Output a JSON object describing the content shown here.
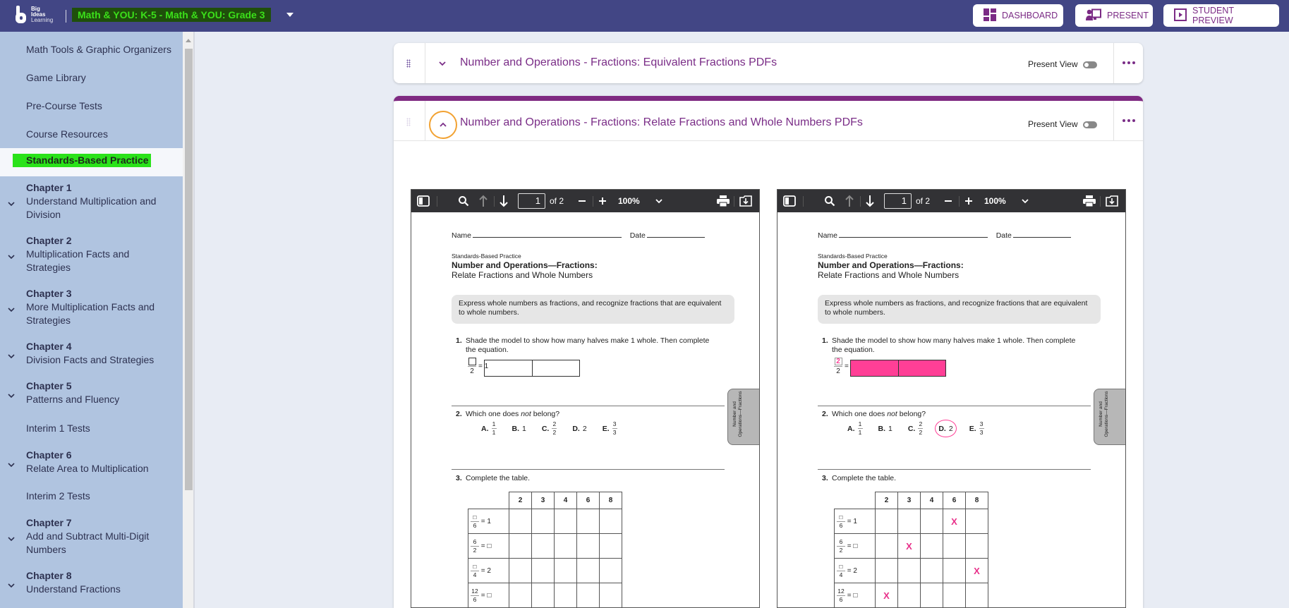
{
  "header": {
    "logo": {
      "line1": "Big",
      "line2": "Ideas",
      "line3": "Learning"
    },
    "course_title": "Math & YOU: K-5 - Math & YOU: Grade 3",
    "buttons": [
      {
        "label": "DASHBOARD",
        "icon": "dashboard-icon"
      },
      {
        "label": "PRESENT",
        "icon": "present-icon"
      },
      {
        "label": "STUDENT PREVIEW",
        "icon": "play-icon"
      }
    ],
    "accent_color": "#424685",
    "highlight_color": "#2ae21a"
  },
  "sidebar": {
    "items": [
      {
        "label": "Math Tools & Graphic Organizers"
      },
      {
        "label": "Game Library"
      },
      {
        "label": "Pre-Course Tests"
      },
      {
        "label": "Course Resources"
      },
      {
        "label": "Standards-Based Practice",
        "active": true
      },
      {
        "chapter": "Chapter 1",
        "label": "Understand Multiplication and Division"
      },
      {
        "chapter": "Chapter 2",
        "label": "Multiplication Facts and Strategies"
      },
      {
        "chapter": "Chapter 3",
        "label": "More Multiplication Facts and Strategies"
      },
      {
        "chapter": "Chapter 4",
        "label": "Division Facts and Strategies"
      },
      {
        "chapter": "Chapter 5",
        "label": "Patterns and Fluency"
      },
      {
        "label": "Interim 1 Tests"
      },
      {
        "chapter": "Chapter 6",
        "label": "Relate Area to Multiplication"
      },
      {
        "label": "Interim 2 Tests"
      },
      {
        "chapter": "Chapter 7",
        "label": "Add and Subtract Multi-Digit Numbers"
      },
      {
        "chapter": "Chapter 8",
        "label": "Understand Fractions"
      }
    ]
  },
  "cards": [
    {
      "title": "Number and Operations - Fractions: Equivalent Fractions PDFs",
      "present_view_label": "Present View",
      "present_view_on": false,
      "expanded": false
    },
    {
      "title": "Number and Operations - Fractions: Relate Fractions and Whole Numbers PDFs",
      "present_view_label": "Present View",
      "present_view_on": false,
      "expanded": true
    }
  ],
  "pdf_viewers": [
    {
      "page": "1",
      "of_label": "of 2",
      "zoom": "100%",
      "doc": {
        "name_label": "Name",
        "date_label": "Date",
        "kicker": "Standards-Based Practice",
        "title": "Number and Operations—Fractions:",
        "subtitle": "Relate Fractions and Whole Numbers",
        "objective": "Express whole numbers as fractions, and recognize fractions that are equivalent to whole numbers.",
        "q1": {
          "num": "1.",
          "text": "Shade the model to show how many halves make 1 whole. Then complete the equation.",
          "numerator": "",
          "denominator": "2",
          "rhs": "= 1",
          "shaded": false
        },
        "q2": {
          "num": "2.",
          "text_pre": "Which one does ",
          "text_em": "not",
          "text_post": " belong?",
          "choices": [
            {
              "letter": "A.",
              "num": "1",
              "den": "1"
            },
            {
              "letter": "B.",
              "value": "1"
            },
            {
              "letter": "C.",
              "num": "2",
              "den": "2"
            },
            {
              "letter": "D.",
              "value": "2",
              "circled": false
            },
            {
              "letter": "E.",
              "num": "3",
              "den": "3"
            }
          ]
        },
        "q3": {
          "num": "3.",
          "text": "Complete the table.",
          "columns": [
            "2",
            "3",
            "4",
            "6",
            "8"
          ],
          "rows": [
            {
              "num": "□",
              "den": "6",
              "rhs": "= 1",
              "marks": [
                "",
                "",
                "",
                "",
                ""
              ]
            },
            {
              "num": "6",
              "den": "2",
              "rhs": "= □",
              "marks": [
                "",
                "",
                "",
                "",
                ""
              ]
            },
            {
              "num": "□",
              "den": "4",
              "rhs": "= 2",
              "marks": [
                "",
                "",
                "",
                "",
                ""
              ]
            },
            {
              "num": "12",
              "den": "6",
              "rhs": "= □",
              "marks": [
                "",
                "",
                "",
                "",
                ""
              ]
            }
          ]
        },
        "side_tab": "Number and Operations—Fractions"
      }
    },
    {
      "page": "1",
      "of_label": "of 2",
      "zoom": "100%",
      "doc": {
        "name_label": "Name",
        "date_label": "Date",
        "kicker": "Standards-Based Practice",
        "title": "Number and Operations—Fractions:",
        "subtitle": "Relate Fractions and Whole Numbers",
        "objective": "Express whole numbers as fractions, and recognize fractions that are equivalent to whole numbers.",
        "q1": {
          "num": "1.",
          "text": "Shade the model to show how many halves make 1 whole. Then complete the equation.",
          "numerator": "2",
          "denominator": "2",
          "rhs": "= 1",
          "shaded": true
        },
        "q2": {
          "num": "2.",
          "text_pre": "Which one does ",
          "text_em": "not",
          "text_post": " belong?",
          "choices": [
            {
              "letter": "A.",
              "num": "1",
              "den": "1"
            },
            {
              "letter": "B.",
              "value": "1"
            },
            {
              "letter": "C.",
              "num": "2",
              "den": "2"
            },
            {
              "letter": "D.",
              "value": "2",
              "circled": true
            },
            {
              "letter": "E.",
              "num": "3",
              "den": "3"
            }
          ]
        },
        "q3": {
          "num": "3.",
          "text": "Complete the table.",
          "columns": [
            "2",
            "3",
            "4",
            "6",
            "8"
          ],
          "rows": [
            {
              "num": "□",
              "den": "6",
              "rhs": "= 1",
              "marks": [
                "",
                "",
                "",
                "X",
                ""
              ]
            },
            {
              "num": "6",
              "den": "2",
              "rhs": "= □",
              "marks": [
                "",
                "X",
                "",
                "",
                ""
              ]
            },
            {
              "num": "□",
              "den": "4",
              "rhs": "= 2",
              "marks": [
                "",
                "",
                "",
                "",
                "X"
              ]
            },
            {
              "num": "12",
              "den": "6",
              "rhs": "= □",
              "marks": [
                "X",
                "",
                "",
                "",
                ""
              ]
            }
          ]
        },
        "side_tab": "Number and Operations—Fractions"
      }
    }
  ],
  "annotation_color": "#ff3f96",
  "title_color": "#7a2d87"
}
